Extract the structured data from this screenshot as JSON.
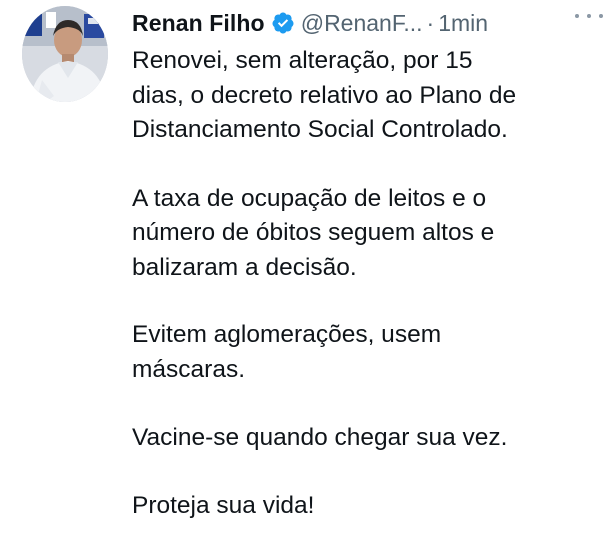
{
  "tweet": {
    "author": {
      "display_name": "Renan Filho",
      "handle": "@RenanF...",
      "verified": true,
      "avatar_icon": "profile-photo"
    },
    "separator": "·",
    "time": "1min",
    "more_icon": "more-horizontal-icon",
    "colors": {
      "verified": "#1d9bf0",
      "text": "#0f1419",
      "muted": "#536471"
    },
    "text": {
      "p1_lines": [
        "Renovei, sem alteração, por 15",
        "dias, o decreto relativo ao Plano de",
        "Distanciamento Social Controlado."
      ],
      "p2_lines": [
        "A taxa de ocupação de leitos e o",
        "número de óbitos seguem altos e",
        "balizaram a decisão."
      ],
      "p3_lines": [
        "Evitem aglomerações, usem",
        "máscaras."
      ],
      "p4": "Vacine-se quando chegar sua vez.",
      "p5": "Proteja sua vida!"
    }
  }
}
